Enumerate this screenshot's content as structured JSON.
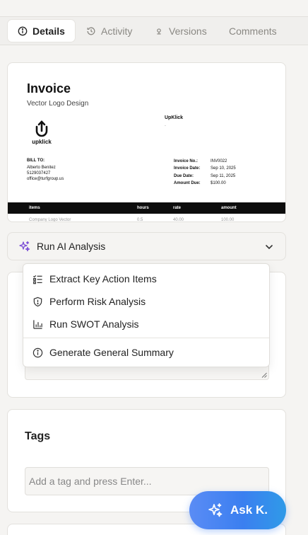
{
  "tabs": [
    {
      "label": "Details",
      "icon": "info-icon",
      "active": true
    },
    {
      "label": "Activity",
      "icon": "history-icon",
      "active": false
    },
    {
      "label": "Versions",
      "icon": "versions-icon",
      "active": false
    },
    {
      "label": "Comments",
      "icon": "",
      "active": false
    }
  ],
  "invoice": {
    "title": "Invoice",
    "subtitle": "Vector Logo Design",
    "logo_text": "upklick",
    "company": "UpKlick",
    "company_line": ".",
    "bill_to_heading": "BILL TO:",
    "bill_to": [
      "Alberto Benitez",
      "5129037427",
      "office@turfgroup.us"
    ],
    "meta": [
      {
        "key": "Invoice No.:",
        "value": "INV0022"
      },
      {
        "key": "Invoice Date:",
        "value": "Sep 10, 2025"
      },
      {
        "key": "Due Date:",
        "value": "Sep 11, 2025"
      },
      {
        "key": "Amount Due:",
        "value": "$100.00"
      }
    ],
    "columns": [
      "items",
      "hours",
      "rate",
      "amount"
    ],
    "partial_row": [
      "Company Logo Vector",
      "0.5",
      "40.00",
      "100.00"
    ]
  },
  "ai_analysis": {
    "label": "Run AI Analysis",
    "icon": "sparkles-icon",
    "menu": [
      {
        "label": "Extract Key Action Items",
        "icon": "checklist-icon"
      },
      {
        "label": "Perform Risk Analysis",
        "icon": "shield-icon"
      },
      {
        "label": "Run SWOT Analysis",
        "icon": "bar-chart-icon"
      },
      {
        "label": "Generate General Summary",
        "icon": "info-icon"
      }
    ]
  },
  "tags": {
    "title": "Tags",
    "placeholder": "Add a tag and press Enter..."
  },
  "ask_button": {
    "label": "Ask K.",
    "icon": "sparkles-icon"
  },
  "colors": {
    "accent": "#3b7ff0",
    "background": "#f5f4f2"
  }
}
